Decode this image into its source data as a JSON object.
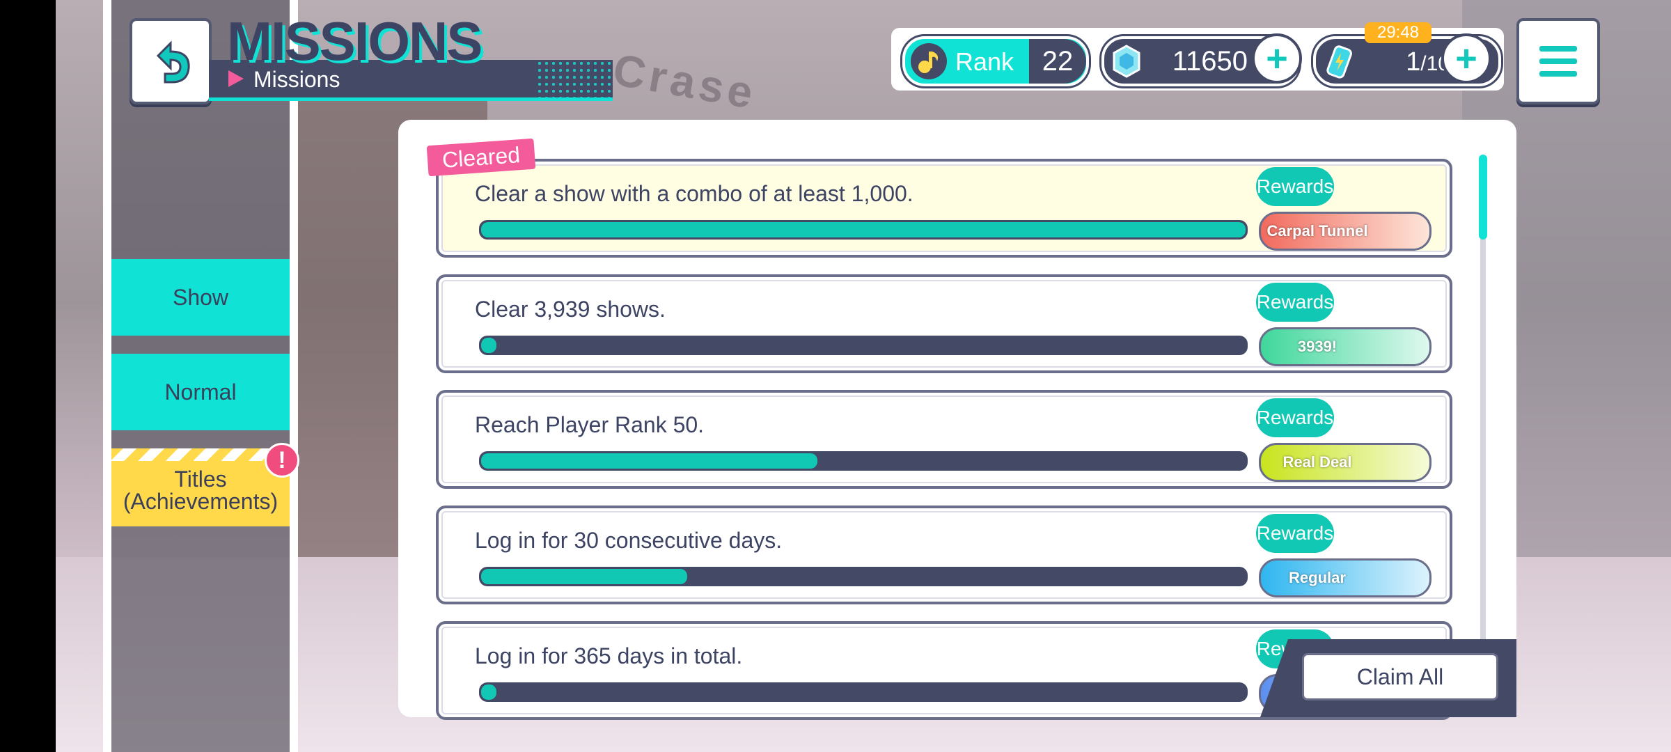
{
  "header": {
    "title": "MISSIONS",
    "subtitle": "Missions",
    "rank_label": "Rank",
    "rank_value": "22",
    "gems": "11650",
    "energy_current": "1",
    "energy_max": "/10",
    "energy_timer": "29:48"
  },
  "sidebar": {
    "tabs": [
      {
        "label": "Show"
      },
      {
        "label": "Normal"
      },
      {
        "label": "Titles\n(Achievements)"
      }
    ],
    "alert": "!"
  },
  "cleared_tag": "Cleared",
  "missions": [
    {
      "text": "Clear a show with a combo of at least 1,000.",
      "progress": 1.0,
      "rewards_label": "Rewards",
      "reward_title": "Carpal Tunnel",
      "plate_color": "#f26a5e",
      "cleared": true
    },
    {
      "text": "Clear 3,939 shows.",
      "progress": 0.02,
      "rewards_label": "Rewards",
      "reward_title": "3939!",
      "plate_color": "#3fd79b",
      "cleared": false
    },
    {
      "text": "Reach Player Rank 50.",
      "progress": 0.44,
      "rewards_label": "Rewards",
      "reward_title": "Real Deal",
      "plate_color": "#c8e41e",
      "cleared": false
    },
    {
      "text": "Log in for 30 consecutive days.",
      "progress": 0.27,
      "rewards_label": "Rewards",
      "reward_title": "Regular",
      "plate_color": "#2fb6f0",
      "cleared": false
    },
    {
      "text": "Log in for 365 days in total.",
      "progress": 0.02,
      "rewards_label": "Rewards",
      "reward_title": "",
      "plate_color": "#5b8ff0",
      "cleared": false
    }
  ],
  "claim_all": "Claim All",
  "colors": {
    "accent": "#10e3d6",
    "dark": "#444a66",
    "pink": "#f45b9b",
    "yellow": "#ffd94a"
  }
}
